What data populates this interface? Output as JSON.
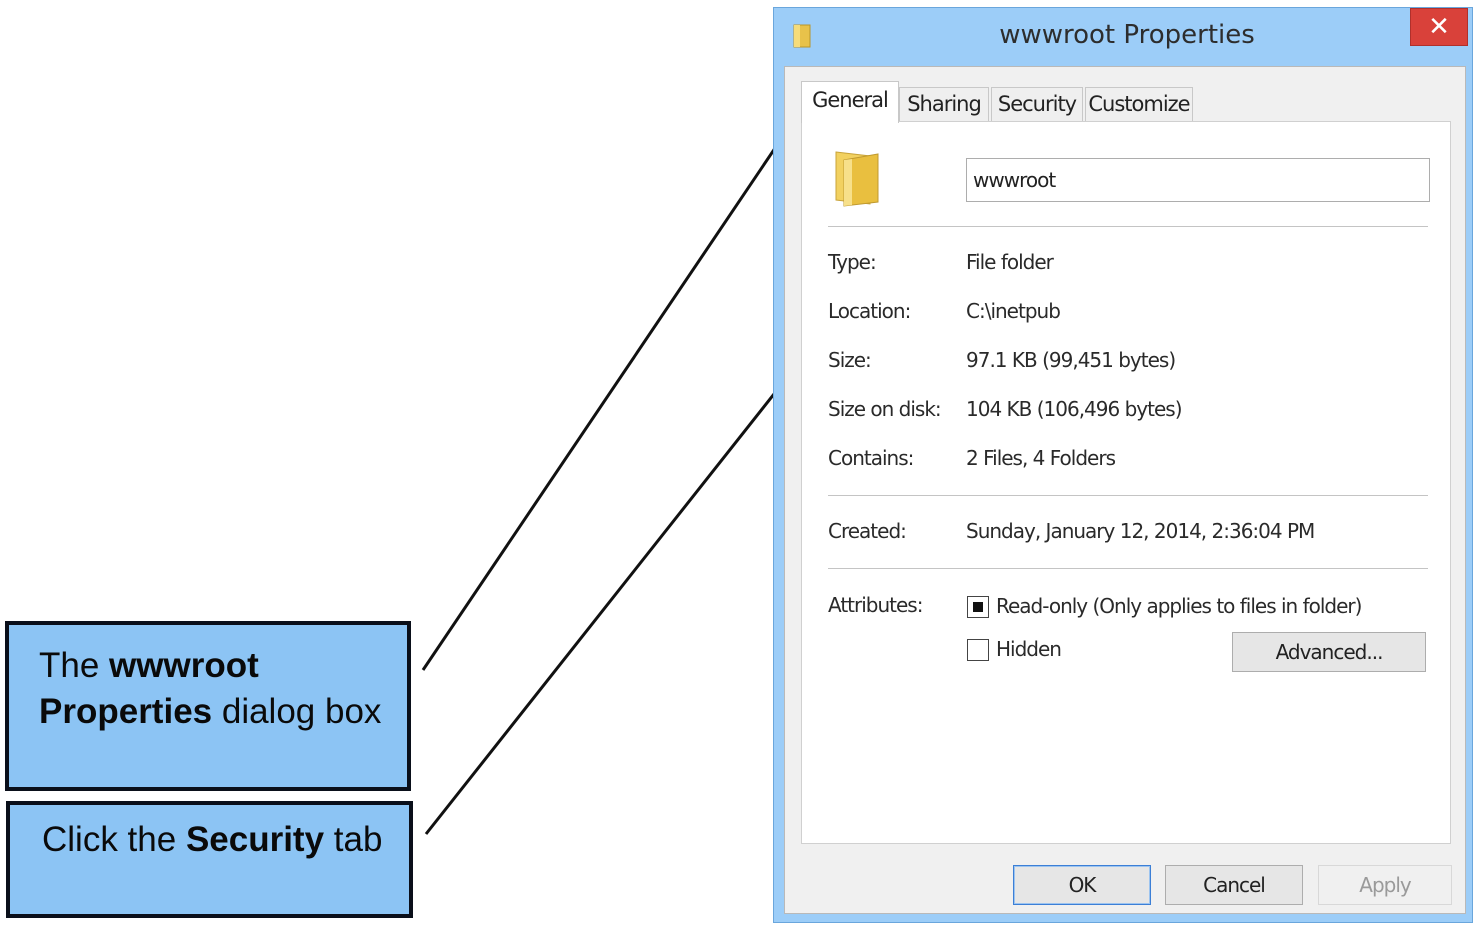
{
  "dialog": {
    "title": "wwwroot Properties",
    "close_label": "✕",
    "tabs": [
      {
        "label": "General",
        "active": true
      },
      {
        "label": "Sharing",
        "active": false
      },
      {
        "label": "Security",
        "active": false
      },
      {
        "label": "Customize",
        "active": false
      }
    ],
    "folder_name": "wwwroot",
    "fields": {
      "type_label": "Type:",
      "type_value": "File folder",
      "location_label": "Location:",
      "location_value": "C:\\inetpub",
      "size_label": "Size:",
      "size_value": "97.1 KB (99,451 bytes)",
      "size_on_disk_label": "Size on disk:",
      "size_on_disk_value": "104 KB (106,496 bytes)",
      "contains_label": "Contains:",
      "contains_value": "2 Files, 4 Folders",
      "created_label": "Created:",
      "created_value": "Sunday, January 12, 2014, 2:36:04 PM"
    },
    "attributes": {
      "label": "Attributes:",
      "readonly_label": "Read-only (Only applies to files in folder)",
      "readonly_state": "indeterminate",
      "hidden_label": "Hidden",
      "hidden_checked": false,
      "advanced_label": "Advanced..."
    },
    "buttons": {
      "ok": "OK",
      "cancel": "Cancel",
      "apply": "Apply"
    }
  },
  "callouts": {
    "first": {
      "pre": "The ",
      "bold1": "wwwroot",
      "bold2": "Properties",
      "post": " dialog box"
    },
    "second": {
      "pre": "Click the ",
      "bold": "Security",
      "post": " tab"
    }
  },
  "colors": {
    "callout_fill": "#8cc4f4",
    "titlebar": "#9ccdf8",
    "close_button": "#d9413a"
  },
  "icons": [
    "folder-icon",
    "close-icon",
    "arrow-icon"
  ]
}
